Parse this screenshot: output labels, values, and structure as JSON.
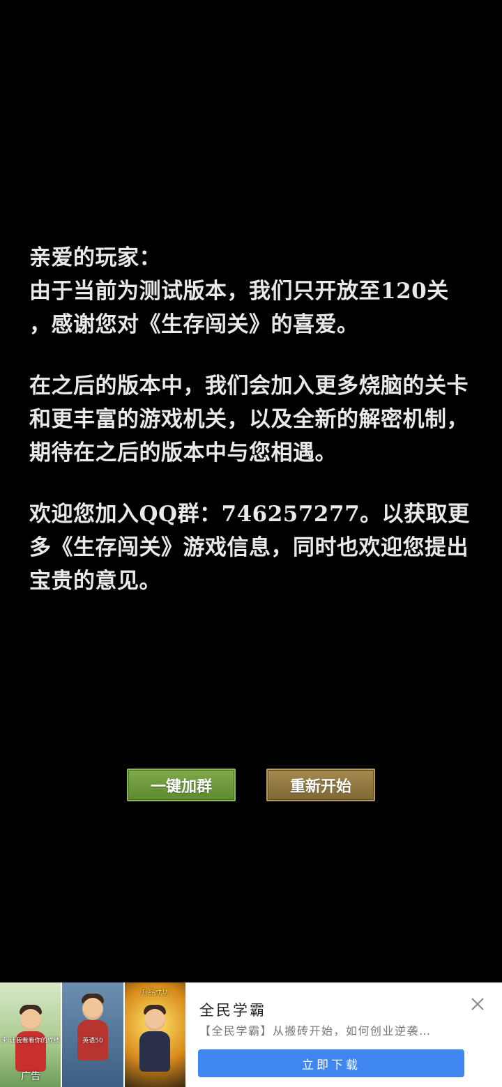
{
  "message": {
    "greeting": "亲爱的玩家：",
    "paragraph1_line1": "由于当前为测试版本，我们只开放至120关",
    "paragraph1_line2": "，感谢您对《生存闯关》的喜爱。",
    "paragraph2": "在之后的版本中，我们会加入更多烧脑的关卡和更丰富的游戏机关，以及全新的解密机制，期待在之后的版本中与您相遇。",
    "paragraph3": "欢迎您加入QQ群：746257277。以获取更多《生存闯关》游戏信息，同时也欢迎您提出宝贵的意见。"
  },
  "buttons": {
    "join_group": "一键加群",
    "restart": "重新开始"
  },
  "ad": {
    "label": "广告",
    "thumb1_caption": "来 让我看看你的成绩",
    "thumb2_caption": "英语50",
    "thumb3_caption": "升品成功",
    "title": "全民学霸",
    "description": "【全民学霸】从搬砖开始，如何创业逆袭…",
    "cta": "立即下载",
    "close_icon": "close-icon"
  },
  "colors": {
    "background": "#000000",
    "text": "#e9e9e9",
    "join_button": "#6a9a3a",
    "restart_button": "#8f7640",
    "cta_button": "#3f86f0"
  }
}
